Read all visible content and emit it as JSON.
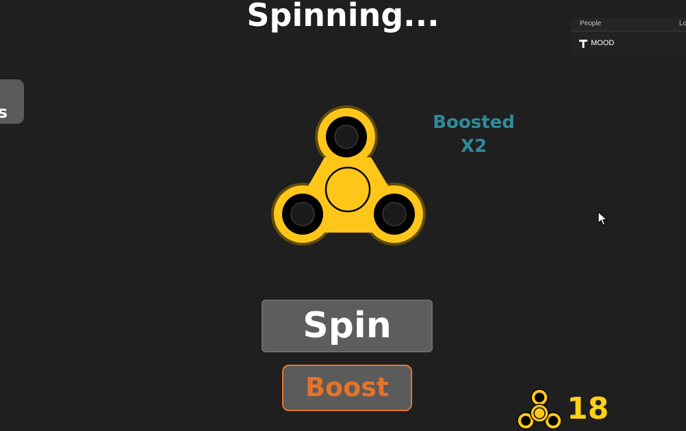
{
  "header": {
    "status": "Spinning..."
  },
  "side_tab": {
    "label": "s"
  },
  "player_list": {
    "columns": [
      "People",
      "Lo"
    ],
    "players": [
      {
        "name": "MOOD",
        "icon": "roblox-player-icon"
      }
    ]
  },
  "spinner": {
    "icon": "fidget-spinner-icon",
    "color": "#ffd21a"
  },
  "boost_status": {
    "line1": "Boosted",
    "line2": "X2",
    "color": "#2e8b9b"
  },
  "actions": {
    "spin_label": "Spin",
    "boost_label": "Boost",
    "boost_color": "#e57328"
  },
  "counter": {
    "icon": "fidget-spinner-icon",
    "value": "18",
    "color": "#ffd21a"
  },
  "colors": {
    "background": "#1f1f1f",
    "button": "#5d5d5d"
  }
}
